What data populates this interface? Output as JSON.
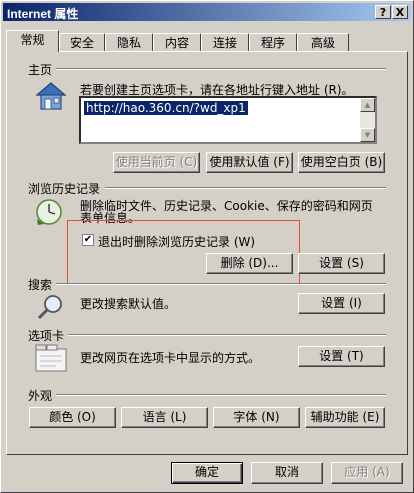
{
  "window": {
    "title": "Internet 属性",
    "help_label": "?",
    "close_label": "X"
  },
  "tabs": [
    {
      "label": "常规"
    },
    {
      "label": "安全"
    },
    {
      "label": "隐私"
    },
    {
      "label": "内容"
    },
    {
      "label": "连接"
    },
    {
      "label": "程序"
    },
    {
      "label": "高级"
    }
  ],
  "homepage": {
    "section": "主页",
    "description": "若要创建主页选项卡，请在各地址行键入地址 (R)。",
    "url": "http://hao.360.cn/?wd_xp1",
    "use_current": "使用当前页 (C)",
    "use_default": "使用默认值 (F)",
    "use_blank": "使用空白页 (B)"
  },
  "history": {
    "section": "浏览历史记录",
    "description_line1": "删除临时文件、历史记录、Cookie、保存的密码和网页",
    "description_line2": "表单信息。",
    "checkbox_label": "退出时删除浏览历史记录 (W)",
    "checkbox_checked": true,
    "delete_button": "删除 (D)...",
    "settings_button": "设置 (S)"
  },
  "search": {
    "section": "搜索",
    "description": "更改搜索默认值。",
    "settings_button": "设置 (I)"
  },
  "tabs_section": {
    "section": "选项卡",
    "description": "更改网页在选项卡中显示的方式。",
    "settings_button": "设置 (T)"
  },
  "appearance": {
    "section": "外观",
    "colors": "颜色 (O)",
    "languages": "语言 (L)",
    "fonts": "字体 (N)",
    "accessibility": "辅助功能 (E)"
  },
  "footer": {
    "ok": "确定",
    "cancel": "取消",
    "apply": "应用 (A)"
  }
}
